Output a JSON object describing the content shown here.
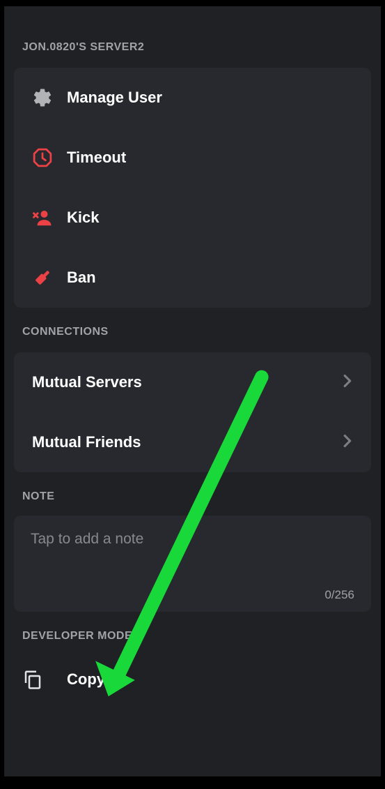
{
  "server": {
    "header": "JON.0820'S SERVER2",
    "actions": {
      "manage_user": "Manage User",
      "timeout": "Timeout",
      "kick": "Kick",
      "ban": "Ban"
    }
  },
  "connections": {
    "header": "CONNECTIONS",
    "mutual_servers": "Mutual Servers",
    "mutual_friends": "Mutual Friends"
  },
  "note": {
    "header": "NOTE",
    "placeholder": "Tap to add a note",
    "counter": "0/256"
  },
  "developer": {
    "header": "DEVELOPER MODE",
    "copy_id": "Copy ID"
  },
  "colors": {
    "danger": "#ed4245",
    "muted": "#a0a3a8",
    "arrow": "#19d83a"
  }
}
